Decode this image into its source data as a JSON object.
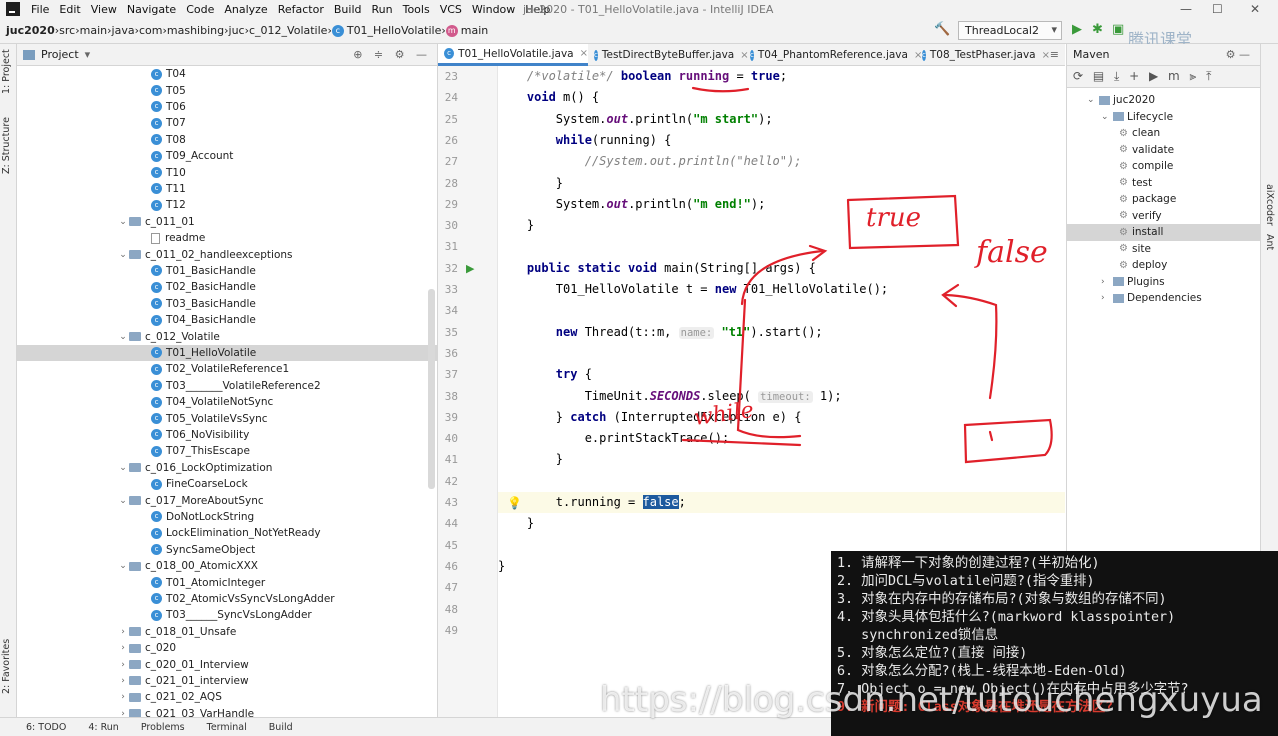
{
  "window": {
    "title": "juc2020 - T01_HelloVolatile.java - IntelliJ IDEA"
  },
  "menu": [
    "File",
    "Edit",
    "View",
    "Navigate",
    "Code",
    "Analyze",
    "Refactor",
    "Build",
    "Run",
    "Tools",
    "VCS",
    "Window",
    "Help"
  ],
  "breadcrumb": [
    "juc2020",
    "src",
    "main",
    "java",
    "com",
    "mashibing",
    "juc",
    "c_012_Volatile",
    "T01_HelloVolatile",
    "main"
  ],
  "run_config": "ThreadLocal2",
  "project_panel": {
    "title": "Project",
    "rows": [
      {
        "label": "T04",
        "type": "class",
        "indent": 2
      },
      {
        "label": "T05",
        "type": "class",
        "indent": 2
      },
      {
        "label": "T06",
        "type": "class",
        "indent": 2
      },
      {
        "label": "T07",
        "type": "class",
        "indent": 2
      },
      {
        "label": "T08",
        "type": "class",
        "indent": 2
      },
      {
        "label": "T09_Account",
        "type": "class",
        "indent": 2
      },
      {
        "label": "T10",
        "type": "class",
        "indent": 2
      },
      {
        "label": "T11",
        "type": "class",
        "indent": 2
      },
      {
        "label": "T12",
        "type": "class",
        "indent": 2
      },
      {
        "label": "c_011_01",
        "type": "folder",
        "indent": 1
      },
      {
        "label": "readme",
        "type": "file",
        "indent": 2
      },
      {
        "label": "c_011_02_handleexceptions",
        "type": "folder",
        "indent": 1
      },
      {
        "label": "T01_BasicHandle",
        "type": "class",
        "indent": 2
      },
      {
        "label": "T02_BasicHandle",
        "type": "class",
        "indent": 2
      },
      {
        "label": "T03_BasicHandle",
        "type": "class",
        "indent": 2
      },
      {
        "label": "T04_BasicHandle",
        "type": "class",
        "indent": 2
      },
      {
        "label": "c_012_Volatile",
        "type": "folder",
        "indent": 1
      },
      {
        "label": "T01_HelloVolatile",
        "type": "class",
        "indent": 2,
        "selected": true
      },
      {
        "label": "T02_VolatileReference1",
        "type": "class",
        "indent": 2
      },
      {
        "label": "T03_______VolatileReference2",
        "type": "class",
        "indent": 2
      },
      {
        "label": "T04_VolatileNotSync",
        "type": "class",
        "indent": 2
      },
      {
        "label": "T05_VolatileVsSync",
        "type": "class",
        "indent": 2
      },
      {
        "label": "T06_NoVisibility",
        "type": "class",
        "indent": 2
      },
      {
        "label": "T07_ThisEscape",
        "type": "class",
        "indent": 2
      },
      {
        "label": "c_016_LockOptimization",
        "type": "folder",
        "indent": 1
      },
      {
        "label": "FineCoarseLock",
        "type": "class",
        "indent": 2
      },
      {
        "label": "c_017_MoreAboutSync",
        "type": "folder",
        "indent": 1
      },
      {
        "label": "DoNotLockString",
        "type": "class",
        "indent": 2
      },
      {
        "label": "LockElimination_NotYetReady",
        "type": "class",
        "indent": 2
      },
      {
        "label": "SyncSameObject",
        "type": "class",
        "indent": 2
      },
      {
        "label": "c_018_00_AtomicXXX",
        "type": "folder",
        "indent": 1
      },
      {
        "label": "T01_AtomicInteger",
        "type": "class",
        "indent": 2
      },
      {
        "label": "T02_AtomicVsSyncVsLongAdder",
        "type": "class",
        "indent": 2
      },
      {
        "label": "T03______SyncVsLongAdder",
        "type": "class",
        "indent": 2
      },
      {
        "label": "c_018_01_Unsafe",
        "type": "folder",
        "indent": 1,
        "collapsed": true
      },
      {
        "label": "c_020",
        "type": "folder",
        "indent": 1,
        "collapsed": true
      },
      {
        "label": "c_020_01_Interview",
        "type": "folder",
        "indent": 1,
        "collapsed": true
      },
      {
        "label": "c_021_01_interview",
        "type": "folder",
        "indent": 1,
        "collapsed": true
      },
      {
        "label": "c_021_02_AQS",
        "type": "folder",
        "indent": 1,
        "collapsed": true
      },
      {
        "label": "c_021_03_VarHandle",
        "type": "folder",
        "indent": 1,
        "collapsed": true
      }
    ]
  },
  "editor_tabs": [
    "T01_HelloVolatile.java",
    "TestDirectByteBuffer.java",
    "T04_PhantomReference.java",
    "T08_TestPhaser.java"
  ],
  "code_lines": [
    {
      "n": "23",
      "html": "    <span class=\"cm\">/*volatile*/</span> <span class=\"kw\">boolean</span> <span class=\"fld\" style=\"color:#660e7a;font-style:normal\">running</span> = <span class=\"kw\">true</span>;"
    },
    {
      "n": "24",
      "html": "    <span class=\"kw\">void</span> m() {"
    },
    {
      "n": "25",
      "html": "        System.<span class=\"fld\">out</span>.println(<span class=\"st\">\"m start\"</span>);"
    },
    {
      "n": "26",
      "html": "        <span class=\"kw\">while</span>(running) {"
    },
    {
      "n": "27",
      "html": "            <span class=\"cm\">//System.out.println(\"hello\");</span>"
    },
    {
      "n": "28",
      "html": "        }"
    },
    {
      "n": "29",
      "html": "        System.<span class=\"fld\">out</span>.println(<span class=\"st\">\"m end!\"</span>);"
    },
    {
      "n": "30",
      "html": "    }"
    },
    {
      "n": "31",
      "html": ""
    },
    {
      "n": "32",
      "html": "    <span class=\"kw\">public static void</span> main(String[] args) {"
    },
    {
      "n": "33",
      "html": "        T01_HelloVolatile t = <span class=\"kw\">new</span> T01_HelloVolatile();"
    },
    {
      "n": "34",
      "html": ""
    },
    {
      "n": "35",
      "html": "        <span class=\"kw\">new</span> Thread(t::m, <span class=\"hint\">name:</span> <span class=\"st\">\"t1\"</span>).start();"
    },
    {
      "n": "36",
      "html": ""
    },
    {
      "n": "37",
      "html": "        <span class=\"kw\">try</span> {"
    },
    {
      "n": "38",
      "html": "            TimeUnit.<span class=\"fld\">SECONDS</span>.sleep( <span class=\"hint\">timeout:</span> 1);"
    },
    {
      "n": "39",
      "html": "        } <span class=\"kw\">catch</span> (InterruptedException e) {"
    },
    {
      "n": "40",
      "html": "            e.printStackTrace();"
    },
    {
      "n": "41",
      "html": "        }"
    },
    {
      "n": "42",
      "html": ""
    },
    {
      "n": "43",
      "html": "        t.running = <span class=\"selbox\">false</span>;"
    },
    {
      "n": "44",
      "html": "    }"
    },
    {
      "n": "45",
      "html": ""
    },
    {
      "n": "46",
      "html": "}"
    },
    {
      "n": "47",
      "html": ""
    },
    {
      "n": "48",
      "html": ""
    },
    {
      "n": "49",
      "html": ""
    }
  ],
  "maven": {
    "title": "Maven",
    "project": "juc2020",
    "lifecycle_label": "Lifecycle",
    "goals": [
      "clean",
      "validate",
      "compile",
      "test",
      "package",
      "verify",
      "install",
      "site",
      "deploy"
    ],
    "selected_goal": "install",
    "plugins_label": "Plugins",
    "dependencies_label": "Dependencies"
  },
  "left_tool_tabs": [
    "1: Project",
    "Z: Structure",
    "2: Favorites"
  ],
  "right_tool_tabs": [
    "aiXcoder",
    "Ant"
  ],
  "bottom_tabs": [
    "6: TODO",
    "4: Run",
    "Problems",
    "Terminal",
    "Build"
  ],
  "overlay": {
    "lines": [
      "1. 请解释一下对象的创建过程?(半初始化)",
      "2. 加问DCL与volatile问题?(指令重排)",
      "3. 对象在内存中的存储布局?(对象与数组的存储不同)",
      "4. 对象头具体包括什么?(markword klasspointer)",
      "   synchronized锁信息",
      "5. 对象怎么定位?(直接 间接)",
      "6. 对象怎么分配?(栈上-线程本地-Eden-Old)",
      "7. Object o = new Object()在内存中占用多少字节?"
    ],
    "last_line": "9. 新问题: Class对象是在堆还是在方法区?"
  },
  "watermark": "https://blog.csdn.net/tutouchengxuyua",
  "logo_text": "腾讯课堂",
  "handwriting": {
    "box1": "true",
    "word2": "false",
    "word3": "while"
  }
}
